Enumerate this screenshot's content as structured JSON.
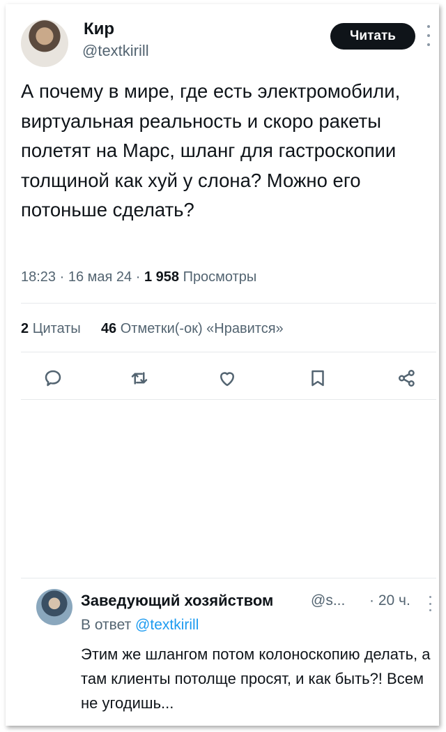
{
  "tweet": {
    "author_name": "Кир",
    "author_handle": "@textkirill",
    "read_button": "Читать",
    "text": "А почему в мире, где есть электромобили, виртуальная реальность и скоро ракеты полетят на Марс, шланг для гастроскопии толщиной как хуй у слона? Можно его потоньше сделать?",
    "time": "18:23",
    "date": "16 мая 24",
    "views_count": "1 958",
    "views_label": "Просмотры",
    "quotes_count": "2",
    "quotes_label": "Цитаты",
    "likes_count": "46",
    "likes_label": "Отметки(-ок) «Нравится»"
  },
  "actions": [
    {
      "name": "reply",
      "icon": "reply-icon"
    },
    {
      "name": "retweet",
      "icon": "retweet-icon"
    },
    {
      "name": "like",
      "icon": "heart-icon"
    },
    {
      "name": "bookmark",
      "icon": "bookmark-icon"
    },
    {
      "name": "share",
      "icon": "share-icon"
    }
  ],
  "reply": {
    "author_name": "Заведующий хозяйством",
    "author_handle": "@s...",
    "time": "· 20 ч.",
    "reply_to_prefix": "В ответ",
    "reply_to_handle": "@textkirill",
    "text": "Этим же шлангом потом колоноскопию делать, а там клиенты потолще просят, и как быть?! Всем не угодишь..."
  },
  "colors": {
    "text": "#0f1419",
    "secondary": "#536471",
    "link": "#1d9bf0",
    "button_bg": "#0f1419"
  }
}
